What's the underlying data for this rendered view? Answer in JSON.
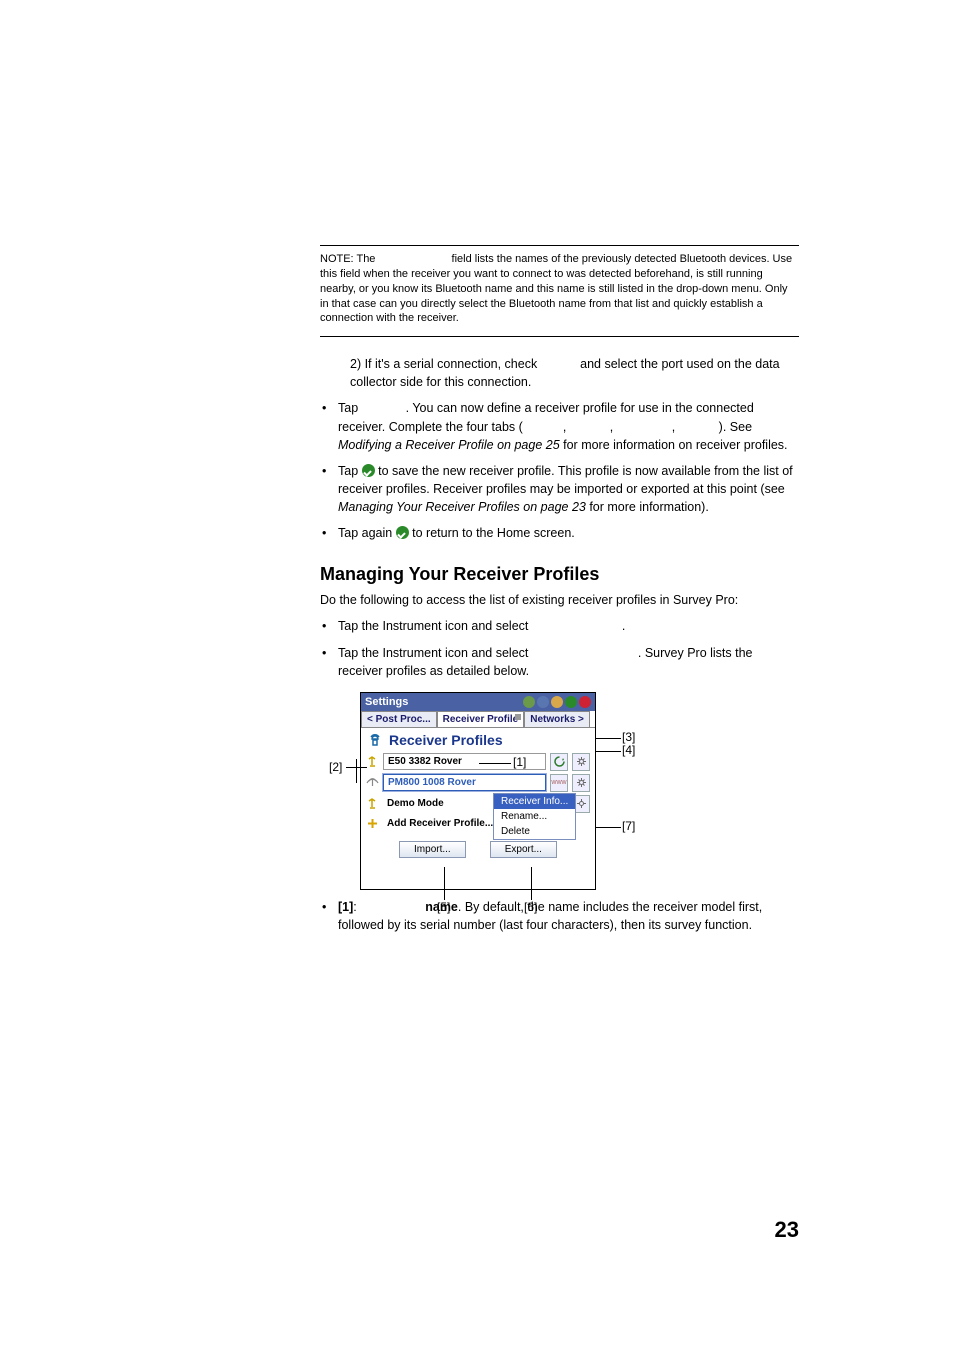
{
  "note": {
    "prefix": "NOTE: The ",
    "text": " field lists the names of the previously detected Bluetooth devices. Use this field when the receiver you want to connect to was detected beforehand, is still running nearby, or you know its Bluetooth name and this name is still listed in the drop-down menu. Only in that case can you directly select the Bluetooth name from that list and quickly establish a connection with the receiver."
  },
  "serial": {
    "prefix": "2) If it's a serial connection, check ",
    "suffix": " and select the port used on the data collector side for this connection."
  },
  "bul1": {
    "p1a": "Tap ",
    "p1b": ". You can now define a receiver profile for use in the connected receiver. Complete the four tabs (",
    "c": ", ",
    "p1c": "). See ",
    "em1": "Modifying a Receiver Profile on page 25",
    "p1d": " for more information on receiver profiles."
  },
  "bul2": {
    "a": "Tap ",
    "b": " to save the new receiver profile. This profile is now available from the list of receiver profiles. Receiver profiles may be imported or exported at this point (see ",
    "em": "Managing Your Receiver Profiles on page 23",
    "c": " for more information)."
  },
  "bul3": {
    "a": "Tap again ",
    "b": " to return to the Home screen."
  },
  "h2": "Managing Your Receiver Profiles",
  "intro": "Do the following to access the list of existing receiver profiles in Survey Pro:",
  "li1": {
    "a": "Tap the Instrument icon and select ",
    "b": "."
  },
  "li2": {
    "a": "Tap the Instrument icon and select ",
    "b": ". Survey Pro lists the receiver profiles as detailed below."
  },
  "fig": {
    "title": "Settings",
    "tab1": "< Post Proc...",
    "tab2": "Receiver Profile",
    "tab3": "Networks >",
    "header": "Receiver Profiles",
    "r1": "E50 3382 Rover",
    "r2": "PM800 1008 Rover",
    "r3": "Demo Mode",
    "r4": "Add Receiver Profile...",
    "m1": "Receiver Info...",
    "m2": "Rename...",
    "m3": "Delete",
    "b1": "Import...",
    "b2": "Export..."
  },
  "itemdesc": {
    "n": "[1]",
    "sep": ": ",
    "strong": "name",
    "rest": ". By default, the name includes the receiver model first, followed by its serial number (last four characters), then its survey function."
  },
  "page": "23",
  "caps": {
    "c1": "[1]",
    "c2": "[2]",
    "c3": "[3]",
    "c4": "[4]",
    "c5": "[5]",
    "c6": "[6]",
    "c7": "[7]"
  }
}
